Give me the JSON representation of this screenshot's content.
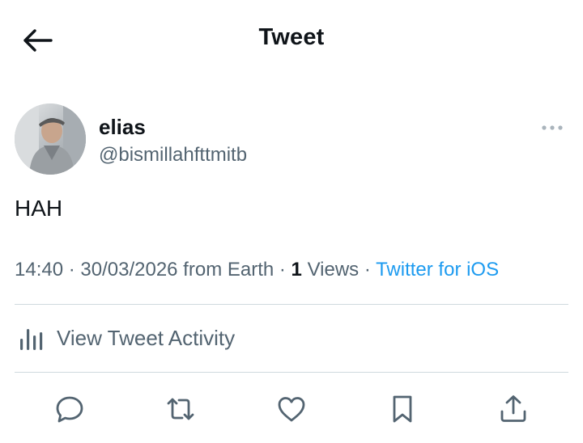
{
  "header": {
    "title": "Tweet",
    "back_icon": "arrow-left-icon"
  },
  "author": {
    "display_name": "elias",
    "handle": "@bismillahfttmitb",
    "avatar_icon": "avatar-photo",
    "more_icon": "more-horizontal-icon"
  },
  "tweet": {
    "text": "HAH"
  },
  "meta": {
    "time": "14:40",
    "sep1": " · ",
    "date": "30/03/2026",
    "location": " from Earth",
    "sep2": " · ",
    "views_count": "1",
    "views_label": " Views",
    "sep3": " · ",
    "source": "Twitter for iOS"
  },
  "activity": {
    "label": "View Tweet Activity",
    "icon": "bar-chart-icon"
  },
  "actions": [
    {
      "icon": "reply-icon"
    },
    {
      "icon": "retweet-icon"
    },
    {
      "icon": "like-icon"
    },
    {
      "icon": "bookmark-icon"
    },
    {
      "icon": "share-icon"
    }
  ],
  "colors": {
    "text_primary": "#0f1419",
    "text_secondary": "#536471",
    "link": "#1d9bf0",
    "divider": "#cfd9de"
  }
}
